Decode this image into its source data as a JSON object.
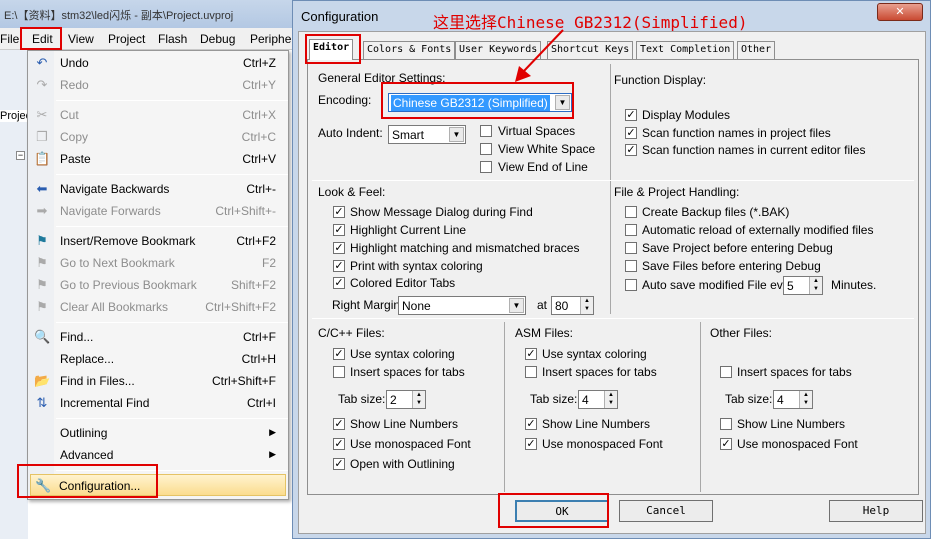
{
  "ide": {
    "title": "E:\\【资料】stm32\\led闪烁 - 副本\\Project.uvproj",
    "menubar": [
      "File",
      "Edit",
      "View",
      "Project",
      "Flash",
      "Debug",
      "Periphe"
    ],
    "tree_label": "Projec"
  },
  "edit_menu": [
    {
      "label": "Undo",
      "key": "Ctrl+Z",
      "icon": "undo-icon",
      "disabled": false
    },
    {
      "label": "Redo",
      "key": "Ctrl+Y",
      "icon": "redo-icon",
      "disabled": true
    },
    {
      "label": "Cut",
      "key": "Ctrl+X",
      "icon": "scissors-icon",
      "disabled": true
    },
    {
      "label": "Copy",
      "key": "Ctrl+C",
      "icon": "copy-icon",
      "disabled": true
    },
    {
      "label": "Paste",
      "key": "Ctrl+V",
      "icon": "paste-icon",
      "disabled": false
    },
    {
      "label": "Navigate Backwards",
      "key": "Ctrl+-",
      "icon": "arrow-left-icon",
      "disabled": false
    },
    {
      "label": "Navigate Forwards",
      "key": "Ctrl+Shift+-",
      "icon": "arrow-right-icon",
      "disabled": true
    },
    {
      "label": "Insert/Remove Bookmark",
      "key": "Ctrl+F2",
      "icon": "bookmark-icon",
      "disabled": false
    },
    {
      "label": "Go to Next Bookmark",
      "key": "F2",
      "icon": "next-bookmark-icon",
      "disabled": true
    },
    {
      "label": "Go to Previous Bookmark",
      "key": "Shift+F2",
      "icon": "prev-bookmark-icon",
      "disabled": true
    },
    {
      "label": "Clear All Bookmarks",
      "key": "Ctrl+Shift+F2",
      "icon": "clear-bookmarks-icon",
      "disabled": true
    },
    {
      "label": "Find...",
      "key": "Ctrl+F",
      "icon": "find-icon",
      "disabled": false
    },
    {
      "label": "Replace...",
      "key": "Ctrl+H",
      "icon": "",
      "disabled": false
    },
    {
      "label": "Find in Files...",
      "key": "Ctrl+Shift+F",
      "icon": "folder-search-icon",
      "disabled": false
    },
    {
      "label": "Incremental Find",
      "key": "Ctrl+I",
      "icon": "incremental-find-icon",
      "disabled": false
    },
    {
      "label": "Outlining",
      "key": "",
      "icon": "",
      "disabled": false,
      "submenu": true
    },
    {
      "label": "Advanced",
      "key": "",
      "icon": "",
      "disabled": false,
      "submenu": true
    },
    {
      "label": "Configuration...",
      "key": "",
      "icon": "wrench-icon",
      "disabled": false,
      "highlighted": true
    }
  ],
  "dialog": {
    "title": "Configuration",
    "close_glyph": "✕",
    "annotation": "这里选择Chinese GB2312(Simplified)",
    "tabs": [
      "Editor",
      "Colors & Fonts",
      "User Keywords",
      "Shortcut Keys",
      "Text Completion",
      "Other"
    ],
    "general": {
      "heading": "General Editor Settings:",
      "encoding_label": "Encoding:",
      "encoding_value": "Chinese GB2312 (Simplified)",
      "auto_indent_label": "Auto Indent:",
      "auto_indent_value": "Smart",
      "virtual_spaces": "Virtual Spaces",
      "view_white_space": "View White Space",
      "view_end_of_line": "View End of Line"
    },
    "function_display": {
      "heading": "Function Display:",
      "items": [
        "Display Modules",
        "Scan function names in project files",
        "Scan function names in current editor files"
      ]
    },
    "look_feel": {
      "heading": "Look & Feel:",
      "items": [
        "Show Message Dialog during Find",
        "Highlight Current Line",
        "Highlight matching and mismatched braces",
        "Print with syntax coloring",
        "Colored Editor Tabs"
      ],
      "right_margin_label": "Right Margin:",
      "right_margin_value": "None",
      "at_label": "at",
      "at_value": "80"
    },
    "file_project": {
      "heading": "File & Project Handling:",
      "items": [
        "Create Backup files (*.BAK)",
        "Automatic reload of externally modified files",
        "Save Project before entering Debug",
        "Save Files before entering Debug"
      ],
      "autosave_label": "Auto save modified File every",
      "autosave_value": "5",
      "minutes_label": "Minutes."
    },
    "c_files": {
      "heading": "C/C++ Files:",
      "syntax": "Use syntax coloring",
      "insert_spaces": "Insert spaces for tabs",
      "tab_size_label": "Tab size:",
      "tab_size_value": "2",
      "line_numbers": "Show Line Numbers",
      "monospaced": "Use monospaced Font",
      "outlining": "Open with Outlining"
    },
    "asm_files": {
      "heading": "ASM Files:",
      "syntax": "Use syntax coloring",
      "insert_spaces": "Insert spaces for tabs",
      "tab_size_label": "Tab size:",
      "tab_size_value": "4",
      "line_numbers": "Show Line Numbers",
      "monospaced": "Use monospaced Font"
    },
    "other_files": {
      "heading": "Other Files:",
      "insert_spaces": "Insert spaces for tabs",
      "tab_size_label": "Tab size:",
      "tab_size_value": "4",
      "line_numbers": "Show Line Numbers",
      "monospaced": "Use monospaced Font"
    },
    "buttons": {
      "ok": "OK",
      "cancel": "Cancel",
      "help": "Help"
    }
  },
  "colors": {
    "highlight_red": "#e00000",
    "annotation_red": "#e00000",
    "selection_blue": "#3399ff",
    "config_highlight": "#fde7a8"
  }
}
